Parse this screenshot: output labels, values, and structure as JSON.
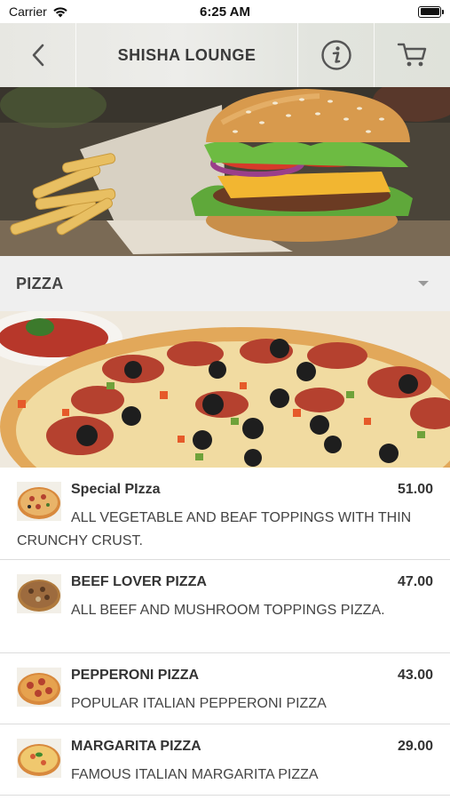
{
  "status_bar": {
    "carrier": "Carrier",
    "time": "6:25 AM"
  },
  "nav": {
    "title": "SHISHA LOUNGE"
  },
  "category": {
    "title": "PIZZA"
  },
  "menu_items": [
    {
      "name": "Special PIzza",
      "price": "51.00",
      "description": "ALL VEGETABLE AND BEAF TOPPINGS WITH THIN CRUNCHY CRUST."
    },
    {
      "name": "BEEF LOVER PIZZA",
      "price": "47.00",
      "description": "ALL BEEF AND MUSHROOM TOPPINGS PIZZA."
    },
    {
      "name": "PEPPERONI PIZZA",
      "price": "43.00",
      "description": "POPULAR ITALIAN PEPPERONI PIZZA"
    },
    {
      "name": "MARGARITA PIZZA",
      "price": "29.00",
      "description": "FAMOUS ITALIAN MARGARITA PIZZA"
    }
  ],
  "colors": {
    "nav_background": "#e7e7e2",
    "category_background": "#efefef",
    "text": "#333333",
    "divider": "#dcdcdc"
  }
}
